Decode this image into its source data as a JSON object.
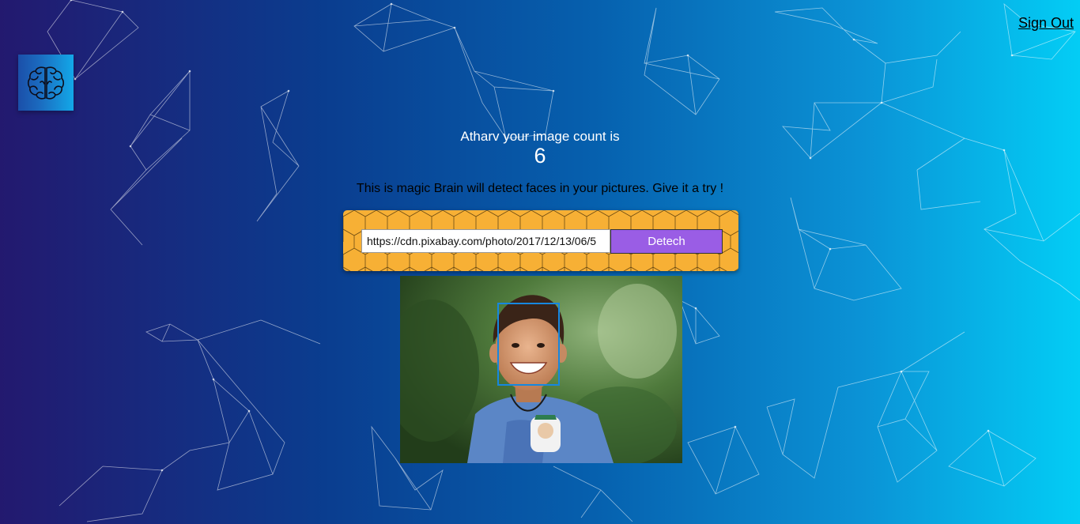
{
  "header": {
    "signout_label": "Sign Out",
    "logo_icon": "brain-icon"
  },
  "rank": {
    "label": "Atharv your image count is",
    "count": "6"
  },
  "main": {
    "tagline": "This is magic Brain will detect faces in your pictures. Give it a try !",
    "url_input_value": "https://cdn.pixabay.com/photo/2017/12/13/06/5",
    "detect_button_label": "Detech"
  },
  "colors": {
    "gradient_start": "#23196f",
    "gradient_end": "#03cdf5",
    "panel_orange": "#f7b035",
    "button_purple": "#9a5de5",
    "face_box_blue": "#1687e0"
  }
}
